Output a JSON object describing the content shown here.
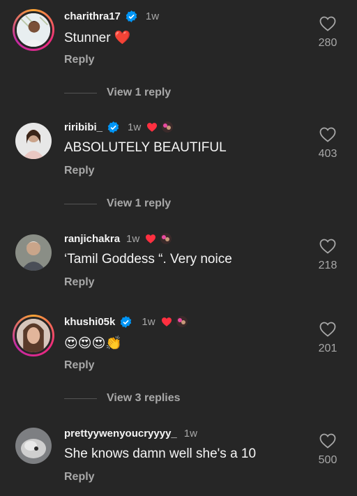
{
  "comments": [
    {
      "username": "charithra17",
      "verified": true,
      "time": "1w",
      "text": "Stunner ❤️",
      "reply": "Reply",
      "likes": "280",
      "view_replies": "View 1 reply"
    },
    {
      "username": "riribibi_",
      "verified": true,
      "time": "1w",
      "text": "ABSOLUTELY BEAUTIFUL",
      "reply": "Reply",
      "likes": "403",
      "view_replies": "View 1 reply"
    },
    {
      "username": "ranjichakra",
      "verified": false,
      "time": "1w",
      "text": "‘Tamil Goddess “. Very noice",
      "reply": "Reply",
      "likes": "218"
    },
    {
      "username": "khushi05k",
      "verified": true,
      "time": "1w",
      "text": "😍😍😍👏",
      "reply": "Reply",
      "likes": "201",
      "view_replies": "View 3 replies"
    },
    {
      "username": "prettyywenyoucryyyy_",
      "verified": false,
      "time": "1w",
      "text": "She knows damn well she's a 10",
      "reply": "Reply",
      "likes": "500"
    }
  ],
  "colors": {
    "background": "#262626",
    "text": "#f5f5f5",
    "muted": "#a8a8a8",
    "verified": "#0095f6",
    "heart": "#ff3040"
  },
  "icons": {
    "like": "heart-outline-icon",
    "verified": "verified-badge-icon",
    "creator_like": "heart-filled-icon"
  }
}
